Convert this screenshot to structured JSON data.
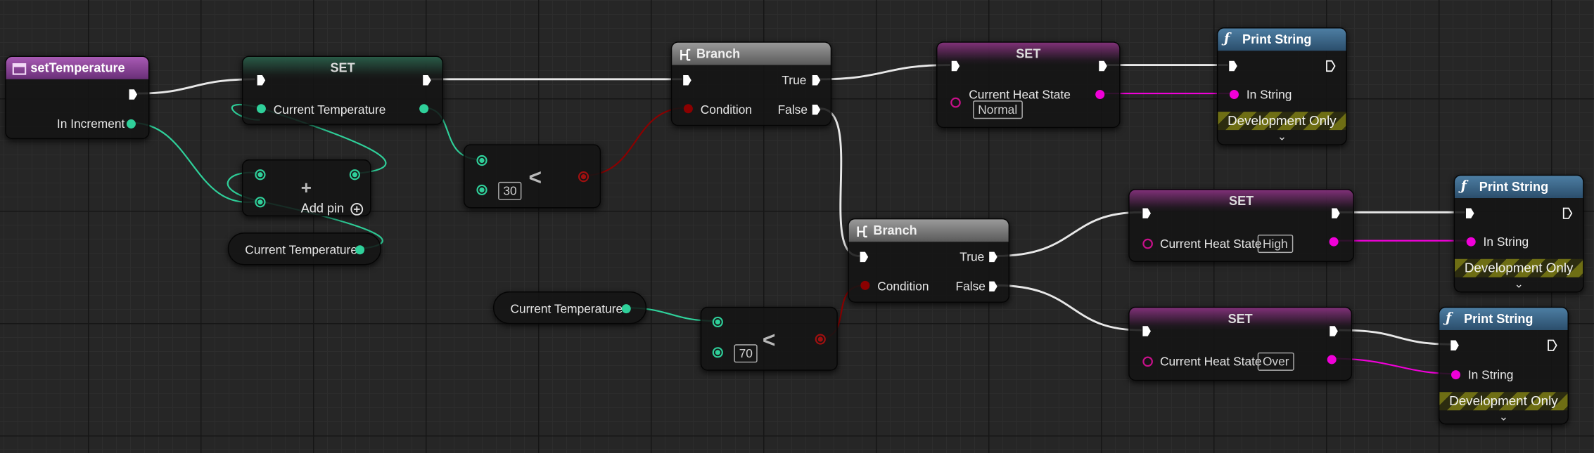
{
  "colors": {
    "background": "#262626",
    "exec_wire": "#e8e8e8",
    "float_pin": "#2fd09a",
    "bool_pin": "#8b0000",
    "string_pin": "#f000d8",
    "enum_pin": "#c8108a"
  },
  "event": {
    "title": "setTemperature",
    "param": "In Increment"
  },
  "set_temp": {
    "title": "SET",
    "var": "Current Temperature"
  },
  "add_node": {
    "add_pin_label": "Add pin"
  },
  "get_temp_1": {
    "label": "Current Temperature"
  },
  "get_temp_2": {
    "label": "Current Temperature"
  },
  "less_1": {
    "op": "<",
    "value": "30"
  },
  "less_2": {
    "op": "<",
    "value": "70"
  },
  "branch_1": {
    "title": "Branch",
    "condition": "Condition",
    "true_label": "True",
    "false_label": "False"
  },
  "branch_2": {
    "title": "Branch",
    "condition": "Condition",
    "true_label": "True",
    "false_label": "False"
  },
  "set_normal": {
    "title": "SET",
    "var": "Current Heat State",
    "value": "Normal"
  },
  "set_high": {
    "title": "SET",
    "var": "Current Heat State",
    "value": "High"
  },
  "set_over": {
    "title": "SET",
    "var": "Current Heat State",
    "value": "Over"
  },
  "print_1": {
    "title": "Print String",
    "in_label": "In String",
    "dev_label": "Development Only"
  },
  "print_2": {
    "title": "Print String",
    "in_label": "In String",
    "dev_label": "Development Only"
  },
  "print_3": {
    "title": "Print String",
    "in_label": "In String",
    "dev_label": "Development Only"
  },
  "icons": {
    "event": "event-icon",
    "branch": "branch-icon",
    "function": "function-icon",
    "exec_pin": "exec-pin-icon",
    "data_pin": "data-pin-icon",
    "add": "plus-icon",
    "expand": "chevron-down-icon"
  }
}
